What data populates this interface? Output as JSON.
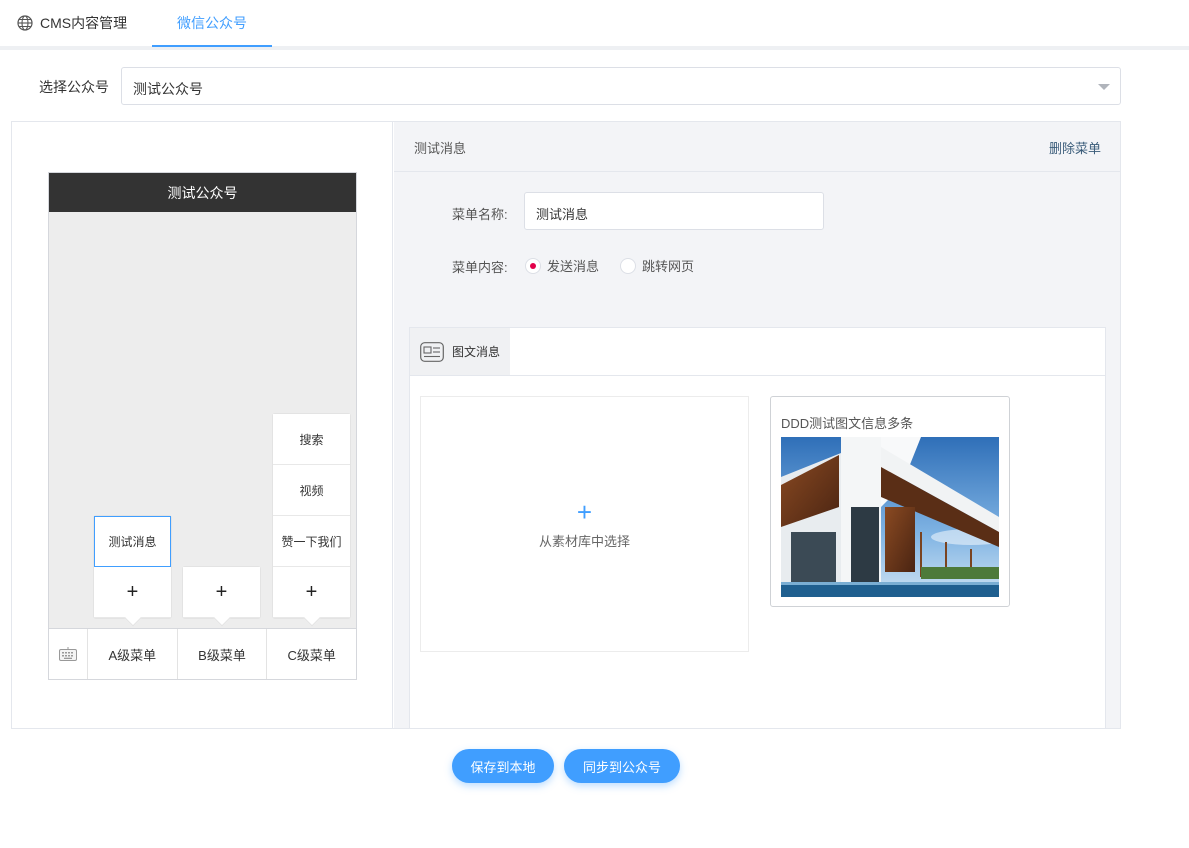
{
  "tabs": [
    {
      "label": "CMS内容管理",
      "icon": "globe-icon"
    },
    {
      "label": "微信公众号",
      "active": true
    }
  ],
  "account_select": {
    "label": "选择公众号",
    "value": "测试公众号"
  },
  "phone": {
    "title": "测试公众号",
    "menus": [
      {
        "label": "A级菜单",
        "sub": [
          "测试消息"
        ],
        "add": "+"
      },
      {
        "label": "B级菜单",
        "sub": [],
        "add": "+"
      },
      {
        "label": "C级菜单",
        "sub": [
          "搜索",
          "视频",
          "赞一下我们"
        ],
        "add": "+"
      }
    ],
    "active_sub": "测试消息"
  },
  "editor": {
    "title": "测试消息",
    "delete_label": "删除菜单",
    "name_label": "菜单名称:",
    "name_value": "测试消息",
    "content_label": "菜单内容:",
    "radio_options": [
      "发送消息",
      "跳转网页"
    ],
    "selected_radio": "发送消息",
    "content_tab": "图文消息",
    "pick_plus": "+",
    "pick_text": "从素材库中选择",
    "article_title": "DDD测试图文信息多条"
  },
  "buttons": {
    "save": "保存到本地",
    "sync": "同步到公众号"
  },
  "colors": {
    "accent": "#409eff",
    "radio_checked": "#e2004a",
    "phone_header": "#333333"
  }
}
